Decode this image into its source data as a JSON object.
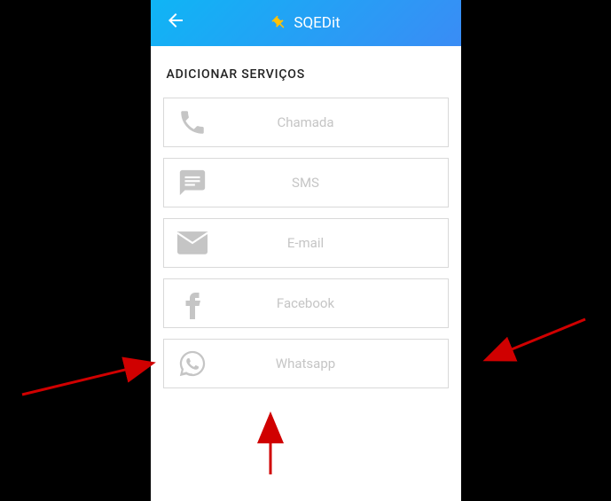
{
  "header": {
    "title": "SQEDit"
  },
  "section": {
    "title": "ADICIONAR SERVIÇOS"
  },
  "services": [
    {
      "id": "chamada",
      "label": "Chamada",
      "icon": "phone-icon"
    },
    {
      "id": "sms",
      "label": "SMS",
      "icon": "sms-icon"
    },
    {
      "id": "email",
      "label": "E-mail",
      "icon": "email-icon"
    },
    {
      "id": "facebook",
      "label": "Facebook",
      "icon": "facebook-icon"
    },
    {
      "id": "whatsapp",
      "label": "Whatsapp",
      "icon": "whatsapp-icon"
    }
  ]
}
